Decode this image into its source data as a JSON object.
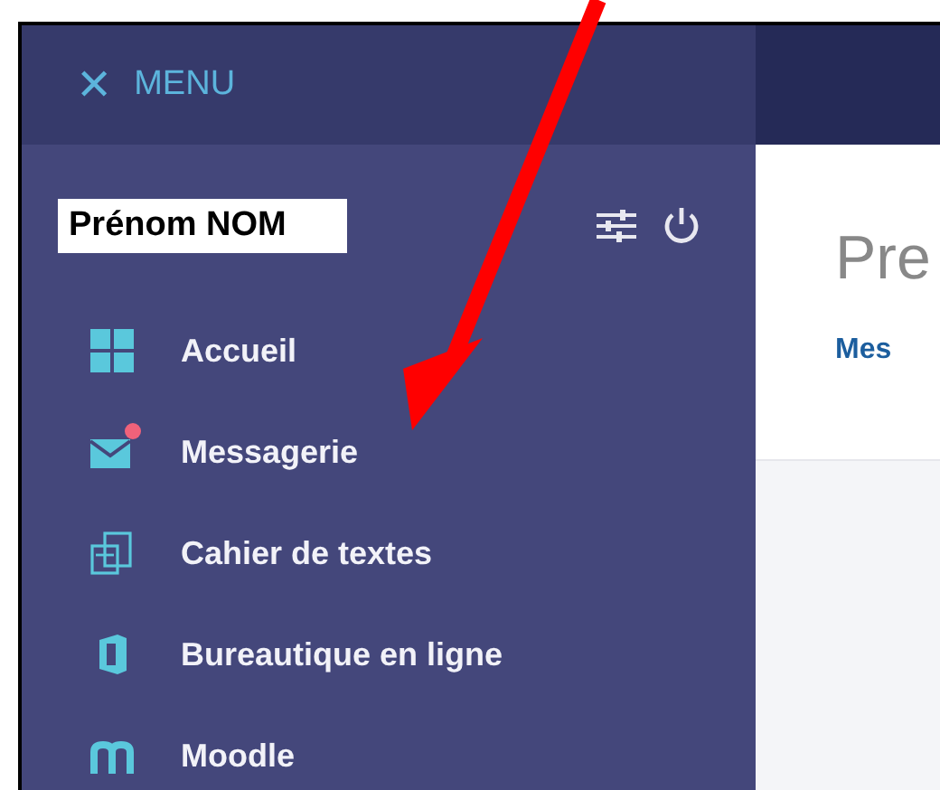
{
  "menu_header": {
    "close_icon": "✕",
    "label": "MENU"
  },
  "user": {
    "name": "Prénom NOM"
  },
  "sidebar": {
    "items": [
      {
        "label": "Accueil",
        "kind": "grid",
        "notification": false
      },
      {
        "label": "Messagerie",
        "kind": "mail",
        "notification": true
      },
      {
        "label": "Cahier de textes",
        "kind": "book",
        "notification": false
      },
      {
        "label": "Bureautique en ligne",
        "kind": "office",
        "notification": false
      },
      {
        "label": "Moodle",
        "kind": "moodle",
        "notification": false
      }
    ]
  },
  "main": {
    "title": "Pre",
    "link": "Mes"
  },
  "annotation": {
    "kind": "arrow"
  }
}
